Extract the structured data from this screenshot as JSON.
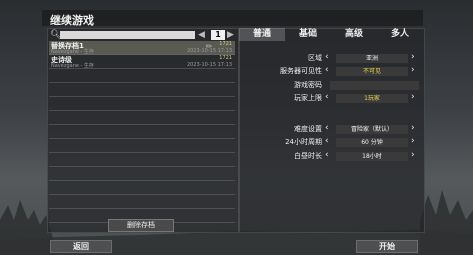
{
  "window": {
    "title": "继续游戏"
  },
  "search": {
    "placeholder": ""
  },
  "pager": {
    "current": "1"
  },
  "saves": [
    {
      "name": "替换存档1",
      "num": "1721",
      "sub": "Navezgane - 生存",
      "date": "2023-10-15 17:13"
    },
    {
      "name": "史诗级",
      "num": "1721",
      "sub": "Navezgane - 生存",
      "date": "2023-10-15 17:13"
    }
  ],
  "delete_label": "删除存档",
  "tabs": [
    "普通",
    "基础",
    "高级",
    "多人"
  ],
  "settings": [
    {
      "label": "区域",
      "value": "亚洲",
      "warn": false
    },
    {
      "label": "服务器可见性",
      "value": "不可见",
      "warn": true
    },
    {
      "label": "游戏密码",
      "value": "",
      "warn": false,
      "textbox": true
    },
    {
      "label": "玩家上限",
      "value": "1玩家",
      "warn": true
    },
    {
      "label": "难度设置",
      "value": "冒险家（默认）",
      "warn": false
    },
    {
      "label": "24小时周期",
      "value": "60 分钟",
      "warn": false
    },
    {
      "label": "白昼时长",
      "value": "18小时",
      "warn": false
    }
  ],
  "footer": {
    "back": "返回",
    "start": "开始"
  }
}
